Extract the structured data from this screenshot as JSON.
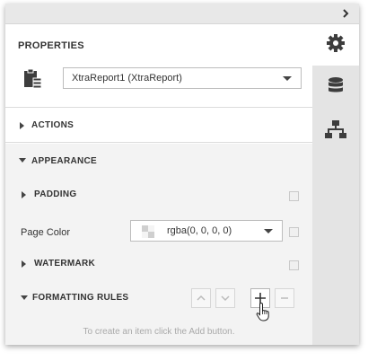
{
  "panel": {
    "top_bar": {
      "collapse_icon": "chevron-right-icon"
    },
    "section_title": "PROPERTIES",
    "report_select": {
      "value": "XtraReport1 (XtraReport)",
      "icon": "report-clipboard-icon"
    },
    "actions": {
      "label": "ACTIONS"
    },
    "appearance": {
      "label": "APPEARANCE",
      "padding": {
        "label": "PADDING"
      },
      "page_color": {
        "label": "Page Color",
        "value": "rgba(0, 0, 0, 0)"
      },
      "watermark": {
        "label": "WATERMARK"
      },
      "formatting_rules": {
        "label": "FORMATTING RULES",
        "buttons": [
          "up-arrow-icon",
          "down-arrow-icon",
          "plus-icon",
          "minus-icon"
        ],
        "hint": "To create an item click the Add button."
      }
    }
  },
  "right_rail": {
    "tabs": [
      {
        "icon": "gear-icon",
        "active": true
      },
      {
        "icon": "database-icon",
        "active": false
      },
      {
        "icon": "hierarchy-icon",
        "active": false
      }
    ]
  },
  "colors": {
    "accent_dark": "#3d3d3d",
    "rail_bg": "#e4e4e4",
    "group_bg": "#f3f3f3"
  }
}
